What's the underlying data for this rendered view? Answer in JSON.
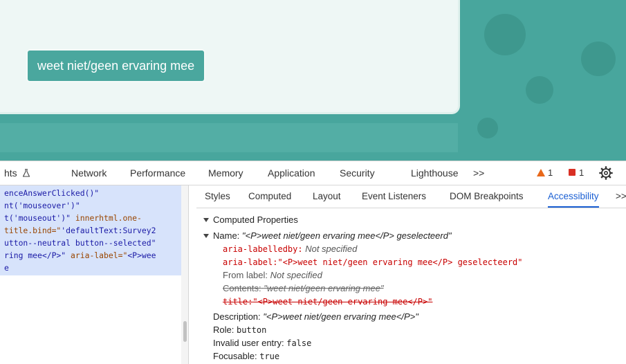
{
  "page": {
    "answer_button": "weet niet/geen ervaring mee"
  },
  "devtools": {
    "tabs": [
      {
        "label": "hts"
      },
      {
        "label": "Network"
      },
      {
        "label": "Performance"
      },
      {
        "label": "Memory"
      },
      {
        "label": "Application"
      },
      {
        "label": "Security"
      },
      {
        "label": "Lighthouse"
      },
      {
        "label": ">>"
      }
    ],
    "warnings_count": "1",
    "errors_count": "1",
    "elements_code": [
      {
        "a": "enceAnswerClicked()\"",
        "b": "",
        "c": ""
      },
      {
        "a": "nt('mouseover')\"",
        "b": "",
        "c": ""
      },
      {
        "a": "t('mouseout')\"",
        "b": " innerhtml.one-",
        "c": ""
      },
      {
        "a": "title.bind=\"",
        "b": "'defaultText:Survey2",
        "c": ""
      },
      {
        "a": "utton--neutral button--selected\"",
        "b": "",
        "c": ""
      },
      {
        "a": "ring mee</P>\"",
        "b": " aria-label=\"",
        "c": "<P>wee"
      },
      {
        "a": "e",
        "b": "",
        "c": ""
      }
    ],
    "sub_tabs": [
      {
        "label": "Styles"
      },
      {
        "label": "Computed"
      },
      {
        "label": "Layout"
      },
      {
        "label": "Event Listeners"
      },
      {
        "label": "DOM Breakpoints"
      },
      {
        "label": "Accessibility"
      },
      {
        "label": ">>"
      }
    ],
    "accessibility": {
      "section_title": "Computed Properties",
      "name_label": "Name:",
      "name_value": "\"<P>weet niet/geen ervaring mee</P> geselecteerd\"",
      "labelledby_label": "aria-labelledby:",
      "labelledby_value": "Not specified",
      "aria_label_label": "aria-label:",
      "aria_label_value": "\"<P>weet niet/geen ervaring mee</P> geselecteerd\"",
      "from_label_label": "From label:",
      "from_label_value": "Not specified",
      "contents_label": "Contents:",
      "contents_value": "\"weet niet/geen ervaring mee\"",
      "title_label": "title:",
      "title_value": "\"<P>weet niet/geen ervaring mee</P>\"",
      "description_label": "Description:",
      "description_value": "\"<P>weet niet/geen ervaring mee</P>\"",
      "role_label": "Role:",
      "role_value": "button",
      "invalid_label": "Invalid user entry:",
      "invalid_value": "false",
      "focusable_label": "Focusable:",
      "focusable_value": "true"
    }
  }
}
